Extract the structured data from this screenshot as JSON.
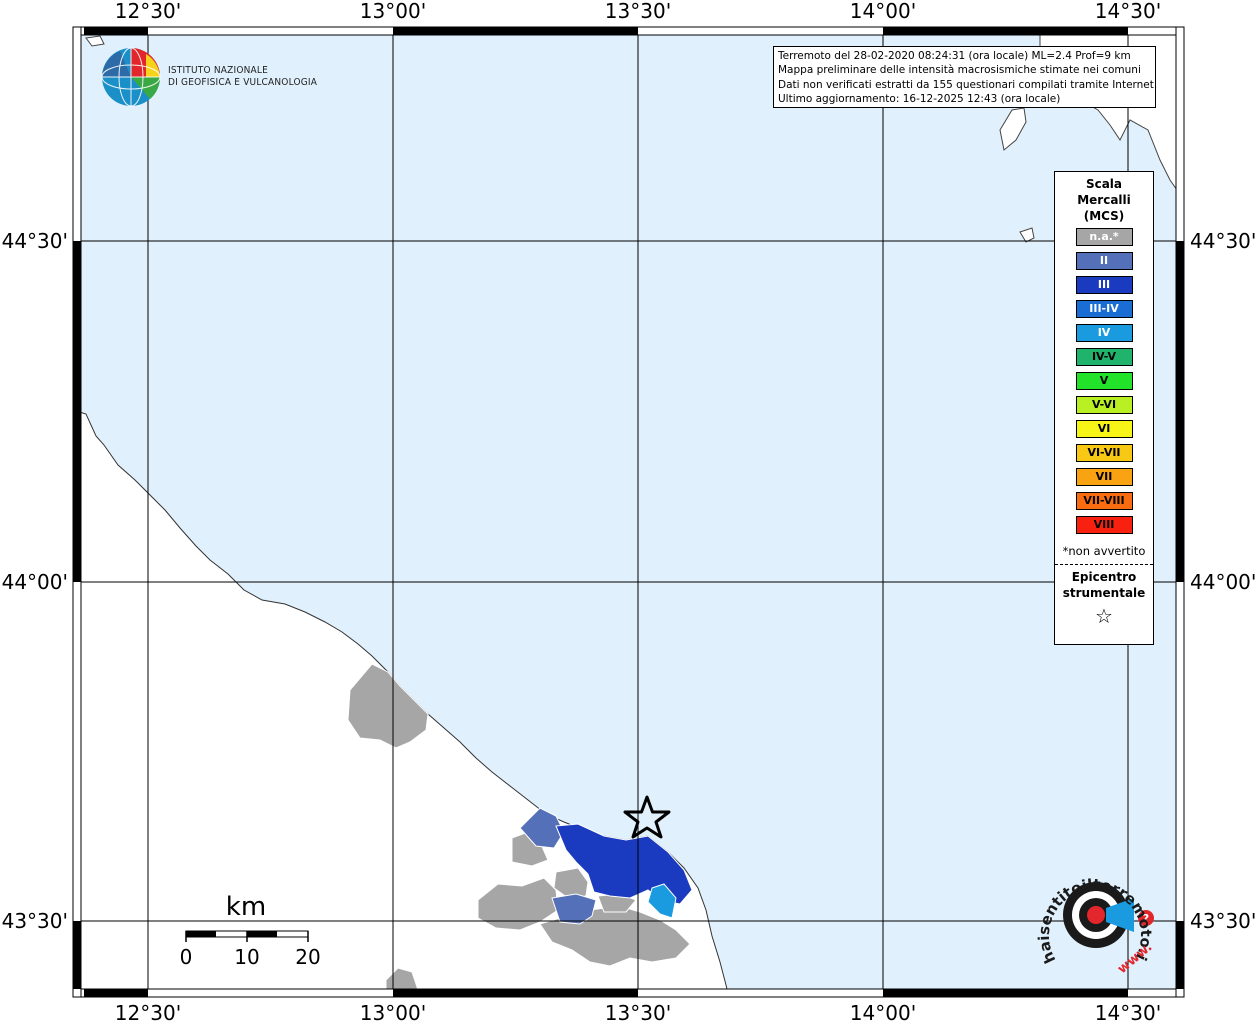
{
  "map": {
    "lon_labels": [
      "12°30'",
      "13°00'",
      "13°30'",
      "14°00'",
      "14°30'"
    ],
    "lat_labels": [
      "44°30'",
      "44°00'",
      "43°30'"
    ]
  },
  "colors": {
    "sea": "#e0f1fd",
    "land": "#ffffff",
    "na": "#a6a6a6"
  },
  "info": {
    "line1": "Terremoto del 28-02-2020 08:24:31 (ora locale) ML=2.4 Prof=9 km",
    "line2": "Mappa preliminare delle intensità macrosismiche stimate nei comuni",
    "line3": "Dati non verificati estratti da 155 questionari compilati tramite Internet.",
    "line4": "Ultimo aggiornamento: 16-12-2025 12:43 (ora locale)"
  },
  "logo": {
    "line1": "ISTITUTO NAZIONALE",
    "line2": "DI GEOFISICA E VULCANOLOGIA"
  },
  "legend": {
    "title1": "Scala",
    "title2": "Mercalli",
    "title3": "(MCS)",
    "items": [
      {
        "label": "n.a.*",
        "color": "#a6a6a6"
      },
      {
        "label": "II",
        "color": "#5470b8"
      },
      {
        "label": "III",
        "color": "#1a3bbf"
      },
      {
        "label": "III-IV",
        "color": "#1a6ed3"
      },
      {
        "label": "IV",
        "color": "#1a9be0"
      },
      {
        "label": "IV-V",
        "color": "#1fb36b"
      },
      {
        "label": "V",
        "color": "#22e32a"
      },
      {
        "label": "V-VI",
        "color": "#b8f024"
      },
      {
        "label": "VI",
        "color": "#f7f518"
      },
      {
        "label": "VI-VII",
        "color": "#f7c814"
      },
      {
        "label": "VII",
        "color": "#f9a212"
      },
      {
        "label": "VII-VIII",
        "color": "#fa6c10"
      },
      {
        "label": "VIII",
        "color": "#f8200f"
      }
    ],
    "na_note": "*non avvertito",
    "epi1": "Epicentro",
    "epi2": "strumentale",
    "star": "☆"
  },
  "scalebar": {
    "unit": "km",
    "labels": [
      "0",
      "10",
      "20"
    ]
  },
  "badge": {
    "text": "haisentitoilterremoto.it",
    "www": "www."
  }
}
